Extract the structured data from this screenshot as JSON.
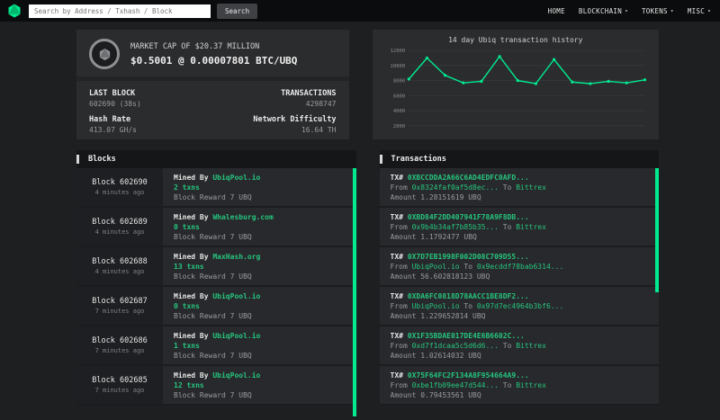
{
  "topbar": {
    "search": {
      "placeholder": "Search by Address / Txhash / Block",
      "button": "Search"
    },
    "menu": [
      {
        "label": "HOME"
      },
      {
        "label": "BLOCKCHAIN"
      },
      {
        "label": "TOKENS"
      },
      {
        "label": "MISC"
      }
    ]
  },
  "stats": {
    "market_cap": "MARKET CAP OF $20.37 MILLION",
    "price": "$0.5001 @ 0.00007801 BTC/UBQ",
    "last_block": {
      "label": "LAST BLOCK",
      "value": "602690 (38s)"
    },
    "transactions": {
      "label": "TRANSACTIONS",
      "value": "4298747"
    },
    "hash_rate": {
      "label": "Hash Rate",
      "value": "413.07 GH/s"
    },
    "difficulty": {
      "label": "Network Difficulty",
      "value": "16.64 TH"
    }
  },
  "chart_data": {
    "type": "line",
    "title": "14 day Ubiq transaction history",
    "x": [
      1,
      2,
      3,
      4,
      5,
      6,
      7,
      8,
      9,
      10,
      11,
      12,
      13,
      14
    ],
    "values": [
      8200,
      11000,
      8700,
      7700,
      7900,
      11200,
      8000,
      7600,
      10800,
      7800,
      7600,
      7900,
      7700,
      8100
    ],
    "yticks": [
      2000,
      4000,
      6000,
      8000,
      10000,
      12000
    ],
    "ylim": [
      2000,
      12000
    ],
    "xlabel": "",
    "ylabel": "",
    "xticks_visible": false,
    "grid": true,
    "legend": false,
    "line_color": "#00ea90"
  },
  "blocks": {
    "title": "Blocks",
    "labels": {
      "mined_by": "Mined By",
      "reward": "Block Reward"
    },
    "rows": [
      {
        "block": "Block 602690",
        "age": "4 minutes ago",
        "miner": "UbiqPool.io",
        "txns": "2 txns",
        "reward": "7 UBQ"
      },
      {
        "block": "Block 602689",
        "age": "4 minutes ago",
        "miner": "Whalesburg.com",
        "txns": "0 txns",
        "reward": "7 UBQ"
      },
      {
        "block": "Block 602688",
        "age": "4 minutes ago",
        "miner": "MaxHash.org",
        "txns": "13 txns",
        "reward": "7 UBQ"
      },
      {
        "block": "Block 602687",
        "age": "7 minutes ago",
        "miner": "UbiqPool.io",
        "txns": "0 txns",
        "reward": "7 UBQ"
      },
      {
        "block": "Block 602686",
        "age": "7 minutes ago",
        "miner": "UbiqPool.io",
        "txns": "1 txns",
        "reward": "7 UBQ"
      },
      {
        "block": "Block 602685",
        "age": "7 minutes ago",
        "miner": "UbiqPool.io",
        "txns": "12 txns",
        "reward": "7 UBQ"
      }
    ]
  },
  "transactions_list": {
    "title": "Transactions",
    "labels": {
      "tx": "TX#",
      "from": "From",
      "to": "To",
      "amount": "Amount"
    },
    "rows": [
      {
        "hash": "0XBCCDDA2A66C6AD4EDFC0AFD...",
        "from": "0x8324faf0af5d8ec...",
        "to": "Bittrex",
        "amount": "1.28151619 UBQ"
      },
      {
        "hash": "0XBD84F2DD407941F78A9F8DB...",
        "from": "0x9b4b34af7b85b35...",
        "to": "Bittrex",
        "amount": "1.1792477 UBQ"
      },
      {
        "hash": "0X7D7EB1998F002D08C709D55...",
        "from": "UbiqPool.io",
        "to": "0x9ecddf78bab6314...",
        "amount": "56.602818123 UBQ"
      },
      {
        "hash": "0XDA6FC0818D78AACC1BE8DF2...",
        "from": "UbiqPool.io",
        "to": "0x97d7ec4964b3bf6...",
        "amount": "1.229652814 UBQ"
      },
      {
        "hash": "0X1F35BDAE017DE4E6B6602C...",
        "from": "0xd7f1dcaa5c5d6d6...",
        "to": "Bittrex",
        "amount": "1.02614032 UBQ"
      },
      {
        "hash": "0X75F64FC2F134A8F954664A9...",
        "from": "0xbe1fb09ee47d544...",
        "to": "Bittrex",
        "amount": "0.79453561 UBQ"
      }
    ]
  },
  "colors": {
    "accent_green": "#00ea90",
    "link_green": "#25c57e"
  }
}
